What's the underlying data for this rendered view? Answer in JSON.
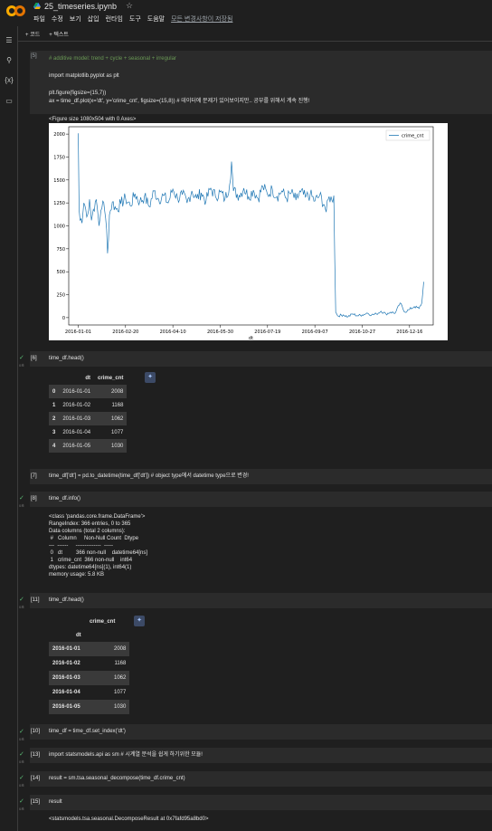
{
  "app": {
    "file_name": "25_timeseries.ipynb",
    "star_icon": "star-icon",
    "menu": [
      "파일",
      "수정",
      "보기",
      "삽입",
      "런타임",
      "도구",
      "도움말"
    ],
    "saved_status": "모든 변경사항이 저장됨"
  },
  "toolbar": {
    "add_code": "+ 코드",
    "add_text": "+ 텍스트"
  },
  "cells": {
    "c5": {
      "num": "[5]",
      "lines": [
        "# additive model: trend + cycle + seasonal + irregular",
        "",
        "import matplotlib.pyplot as plt",
        "",
        "plt.figure(figsize=(15,7))",
        "ax = time_df.plot(x='dt', y='crime_cnt', figsize=(15,8)) # 데이터에 문제가 있어보이지만.. 공부를 위해서 계속 진행!"
      ],
      "output": "<Figure size 1080x504 with 0 Axes>"
    },
    "c6": {
      "num": "[6]",
      "code": "time_df.head()"
    },
    "c7": {
      "num": "[7]",
      "code": "time_df['dt'] = pd.to_datetime(time_df['dt']) # object type에서 datetime type으로 변경!"
    },
    "c8": {
      "num": "[8]",
      "code": "time_df.info()",
      "output": "<class 'pandas.core.frame.DataFrame'>\nRangeIndex: 366 entries, 0 to 365\nData columns (total 2 columns):\n #   Column     Non-Null Count  Dtype\n---  ------     --------------  -----\n 0   dt         366 non-null    datetime64[ns]\n 1   crime_cnt  366 non-null    int64\ndtypes: datetime64[ns](1), int64(1)\nmemory usage: 5.8 KB"
    },
    "c11": {
      "num": "[11]",
      "code": "time_df.head()"
    },
    "c10": {
      "num": "[10]",
      "code": "time_df = time_df.set_index('dt')"
    },
    "c13": {
      "num": "[13]",
      "code": "import statsmodels.api as sm # 시계열 분석을 쉽게 하기위한 모듈!"
    },
    "c14": {
      "num": "[14]",
      "code": "result = sm.tsa.seasonal_decompose(time_df.crime_cnt)"
    },
    "c15": {
      "num": "[15]",
      "code": "result",
      "output": "<statsmodels.tsa.seasonal.DecomposeResult at 0x7fafd95a8bd0>"
    }
  },
  "table1": {
    "headers": [
      "",
      "dt",
      "crime_cnt"
    ],
    "rows": [
      [
        "0",
        "2016-01-01",
        "2008"
      ],
      [
        "1",
        "2016-01-02",
        "1168"
      ],
      [
        "2",
        "2016-01-03",
        "1062"
      ],
      [
        "3",
        "2016-01-04",
        "1077"
      ],
      [
        "4",
        "2016-01-05",
        "1030"
      ]
    ]
  },
  "table2": {
    "col_header": "crime_cnt",
    "index_name": "dt",
    "rows": [
      [
        "2016-01-01",
        "2008"
      ],
      [
        "2016-01-02",
        "1168"
      ],
      [
        "2016-01-03",
        "1062"
      ],
      [
        "2016-01-04",
        "1077"
      ],
      [
        "2016-01-05",
        "1030"
      ]
    ]
  },
  "exec_marks": {
    "check": "✓",
    "cell_time": "0초"
  },
  "chart_data": {
    "type": "line",
    "title": "",
    "xlabel": "dt",
    "ylabel": "",
    "legend": "crime_cnt",
    "legend_position": "top-right",
    "ylim": [
      -80,
      2080
    ],
    "yticks": [
      0,
      250,
      500,
      750,
      1000,
      1250,
      1500,
      1750,
      2000
    ],
    "xticks": [
      "2016-01-01",
      "2016-02-20",
      "2016-04-10",
      "2016-05-30",
      "2016-07-19",
      "2016-09-07",
      "2016-10-27",
      "2016-12-16"
    ],
    "color": "#1f77b4",
    "x_start": "2016-01-01",
    "x_end": "2016-12-31",
    "anchor_points": [
      [
        0,
        2008
      ],
      [
        1,
        1168
      ],
      [
        2,
        1062
      ],
      [
        3,
        1077
      ],
      [
        4,
        1030
      ],
      [
        6,
        1250
      ],
      [
        8,
        1180
      ],
      [
        10,
        1120
      ],
      [
        12,
        1290
      ],
      [
        14,
        1060
      ],
      [
        16,
        1180
      ],
      [
        18,
        1260
      ],
      [
        20,
        1210
      ],
      [
        22,
        1000
      ],
      [
        24,
        1170
      ],
      [
        26,
        1270
      ],
      [
        28,
        1160
      ],
      [
        30,
        960
      ],
      [
        31,
        700
      ],
      [
        33,
        1120
      ],
      [
        36,
        1260
      ],
      [
        40,
        1180
      ],
      [
        45,
        1240
      ],
      [
        50,
        1300
      ],
      [
        55,
        1220
      ],
      [
        60,
        1350
      ],
      [
        65,
        1260
      ],
      [
        70,
        1320
      ],
      [
        75,
        1210
      ],
      [
        80,
        1380
      ],
      [
        85,
        1290
      ],
      [
        90,
        1330
      ],
      [
        95,
        1250
      ],
      [
        100,
        1400
      ],
      [
        105,
        1300
      ],
      [
        110,
        1340
      ],
      [
        115,
        1250
      ],
      [
        120,
        1380
      ],
      [
        125,
        1300
      ],
      [
        130,
        1360
      ],
      [
        135,
        1270
      ],
      [
        140,
        1410
      ],
      [
        145,
        1320
      ],
      [
        150,
        1370
      ],
      [
        155,
        1290
      ],
      [
        160,
        1450
      ],
      [
        162,
        1700
      ],
      [
        164,
        1380
      ],
      [
        170,
        1330
      ],
      [
        175,
        1410
      ],
      [
        180,
        1320
      ],
      [
        185,
        1390
      ],
      [
        190,
        1300
      ],
      [
        195,
        1430
      ],
      [
        200,
        1340
      ],
      [
        205,
        1400
      ],
      [
        210,
        1320
      ],
      [
        215,
        1380
      ],
      [
        220,
        1300
      ],
      [
        225,
        1360
      ],
      [
        230,
        1280
      ],
      [
        235,
        1370
      ],
      [
        240,
        1310
      ],
      [
        245,
        1340
      ],
      [
        250,
        1270
      ],
      [
        255,
        1330
      ],
      [
        260,
        1230
      ],
      [
        262,
        1150
      ],
      [
        265,
        1320
      ],
      [
        268,
        1280
      ],
      [
        270,
        1330
      ],
      [
        272,
        60
      ],
      [
        274,
        20
      ],
      [
        280,
        30
      ],
      [
        285,
        10
      ],
      [
        290,
        40
      ],
      [
        295,
        20
      ],
      [
        300,
        30
      ],
      [
        305,
        50
      ],
      [
        310,
        30
      ],
      [
        315,
        40
      ],
      [
        320,
        70
      ],
      [
        325,
        40
      ],
      [
        330,
        60
      ],
      [
        335,
        50
      ],
      [
        340,
        160
      ],
      [
        345,
        60
      ],
      [
        350,
        90
      ],
      [
        355,
        120
      ],
      [
        360,
        100
      ],
      [
        363,
        160
      ],
      [
        365,
        390
      ]
    ]
  }
}
